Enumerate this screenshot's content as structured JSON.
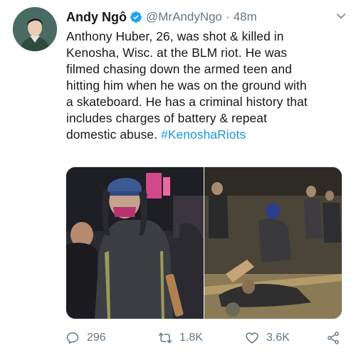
{
  "author": {
    "display_name": "Andy Ngô",
    "handle": "@MrAndyNgo",
    "separator": "·",
    "time": "48m",
    "verified": true
  },
  "tweet": {
    "lines": [
      "Anthony Huber, 26, was shot & killed in",
      "Kenosha, Wisc. at the BLM riot. He was",
      "filmed chasing down the armed teen and",
      "hitting him when he was on the ground with",
      "a skateboard. He has a criminal history that",
      "includes charges of battery & repeat"
    ],
    "last_line": "domestic abuse. ",
    "hashtag": "#KenoshaRiots"
  },
  "media": {
    "count": 2
  },
  "actions": {
    "replies": "296",
    "retweets": "1.8K",
    "likes": "3.6K"
  },
  "colors": {
    "text": "#14171a",
    "secondary": "#657786",
    "link": "#1b95e0",
    "verified": "#1da1f2"
  }
}
